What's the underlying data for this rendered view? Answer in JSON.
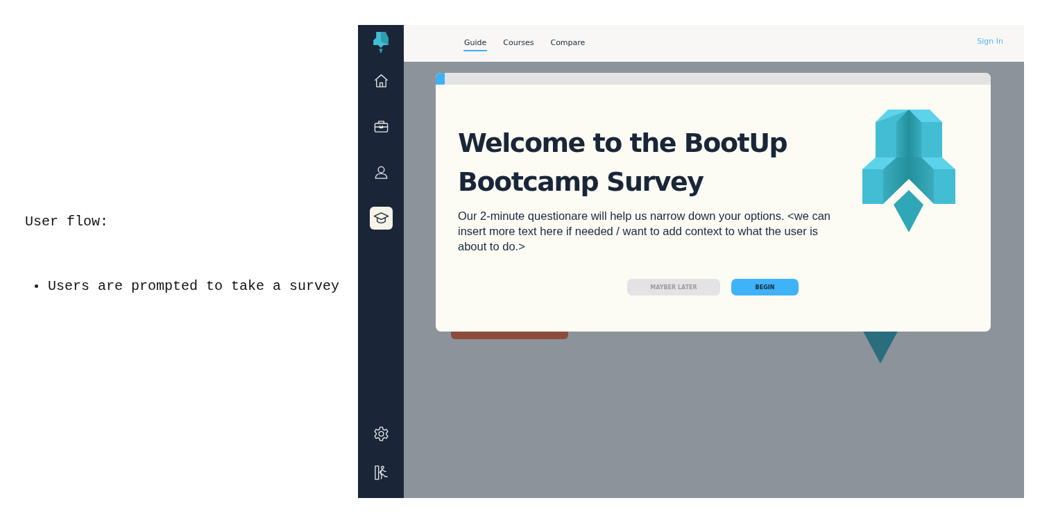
{
  "notes": {
    "heading": "User flow:",
    "bullets": [
      "Users are prompted to take a survey"
    ]
  },
  "sidebar": {
    "items": [
      {
        "kind": "home",
        "selected": false
      },
      {
        "kind": "briefcase",
        "selected": false
      },
      {
        "kind": "user",
        "selected": false
      },
      {
        "kind": "graduation",
        "selected": true
      }
    ],
    "bottom_items": [
      {
        "kind": "settings"
      },
      {
        "kind": "exit"
      }
    ]
  },
  "tabs": [
    {
      "label": "Guide",
      "selected": true
    },
    {
      "label": "Courses",
      "selected": false
    },
    {
      "label": "Compare",
      "selected": false
    }
  ],
  "sign_in": "Sign In",
  "dialog": {
    "title": "Welcome to the BootUp Bootcamp Survey",
    "body": "Our 2-minute questionare will help us narrow down your options. <we can insert more text here if needed / want to add context to what the user is about to do.>",
    "buttons": [
      {
        "label": "MAYBER LATER",
        "kind": "secondary"
      },
      {
        "label": "BEGIN",
        "kind": "primary"
      }
    ]
  }
}
